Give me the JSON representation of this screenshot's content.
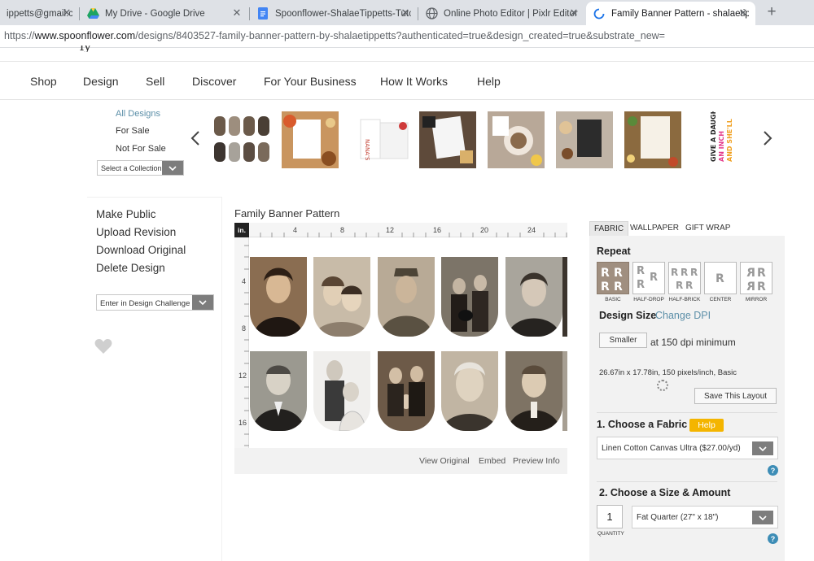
{
  "browser": {
    "tabs": [
      {
        "title": "ippetts@gmail.c"
      },
      {
        "title": "My Drive - Google Drive"
      },
      {
        "title": "Spoonflower-ShalaeTippetts-Tuto"
      },
      {
        "title": "Online Photo Editor | Pixlr Editor"
      },
      {
        "title": "Family Banner Pattern - shalaetip"
      }
    ],
    "url_scheme": "https://",
    "url_host": "www.spoonflower.com",
    "url_path": "/designs/8403527-family-banner-pattern-by-shalaetippetts?authenticated=true&design_created=true&substrate_new="
  },
  "nav": {
    "items": [
      "Shop",
      "Design",
      "Sell",
      "Discover",
      "For Your Business",
      "How It Works",
      "Help"
    ]
  },
  "filters": {
    "all": "All Designs",
    "for_sale": "For Sale",
    "not_for_sale": "Not For Sale",
    "collection_select": "Select a Collection"
  },
  "carousel": {
    "thumb_text_nana": "NANA'S FAMOUS",
    "thumb_text_quote": "GIVE A DAUGHTER AN INCH AND SHE'LL"
  },
  "actions": {
    "make_public": "Make Public",
    "upload_revision": "Upload Revision",
    "download_original": "Download Original",
    "delete_design": "Delete Design",
    "challenge_select": "Enter in Design Challenge"
  },
  "design": {
    "title": "Family Banner Pattern",
    "ruler_unit": "in.",
    "ruler_top": [
      "4",
      "8",
      "12",
      "16",
      "20",
      "24"
    ],
    "ruler_left": [
      "4",
      "8",
      "12",
      "16"
    ],
    "links": {
      "view_original": "View Original",
      "embed": "Embed",
      "preview_info": "Preview Info"
    }
  },
  "product": {
    "tabs": [
      "FABRIC",
      "WALLPAPER",
      "GIFT WRAP"
    ],
    "repeat_label": "Repeat",
    "repeat_options": [
      "BASIC",
      "HALF-DROP",
      "HALF-BRICK",
      "CENTER",
      "MIRROR"
    ],
    "design_size_label": "Design Size",
    "change_dpi": "Change DPI",
    "smaller_button": "Smaller",
    "dpi_text": "at 150 dpi minimum",
    "size_info": "26.67in x 17.78in, 150 pixels/inch, Basic",
    "save_layout": "Save This Layout",
    "choose_fabric": "1. Choose a Fabric",
    "help": "Help",
    "fabric_value": "Linen Cotton Canvas Ultra ($27.00/yd)",
    "choose_size": "2. Choose a Size & Amount",
    "quantity": "1",
    "quantity_label": "QUANTITY",
    "size_value": "Fat Quarter (27\" x 18\")",
    "help_q": "?"
  },
  "colors": {
    "link_blue": "#5c8fa8",
    "help_yellow": "#f4b500",
    "qmark_blue": "#3d8db6",
    "repeat_active": "#a08f80"
  }
}
